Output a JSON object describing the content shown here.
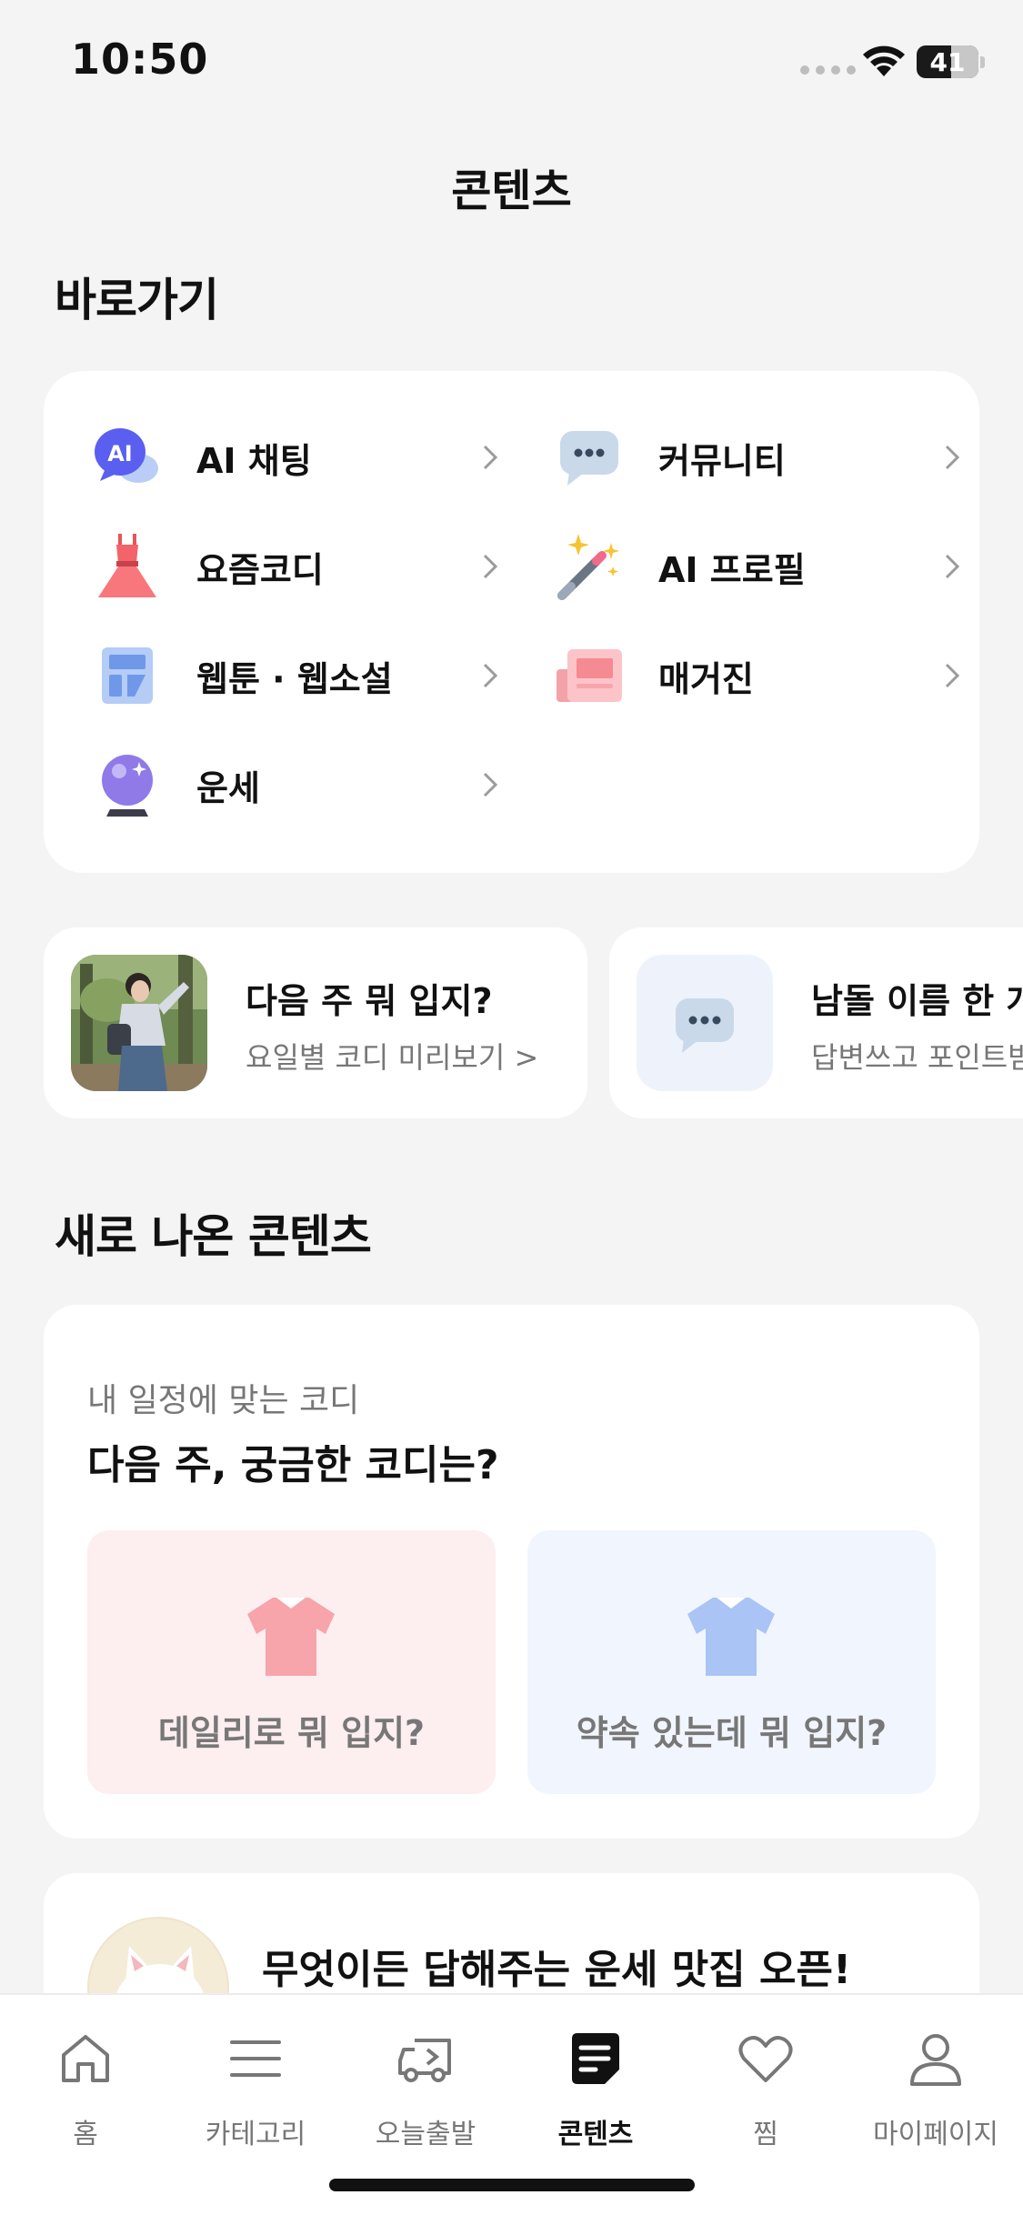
{
  "status_bar": {
    "time": "10:50",
    "battery": "41"
  },
  "header": {
    "title": "콘텐츠"
  },
  "shortcuts": {
    "title": "바로가기",
    "items": [
      {
        "label": "AI 채팅",
        "icon": "ai-chat-bubble-icon",
        "icon_text": "AI"
      },
      {
        "label": "커뮤니티",
        "icon": "community-chat-icon"
      },
      {
        "label": "요즘코디",
        "icon": "dress-icon"
      },
      {
        "label": "AI 프로필",
        "icon": "magic-wand-icon"
      },
      {
        "label": "웹툰 · 웹소설",
        "icon": "webtoon-icon"
      },
      {
        "label": "매거진",
        "icon": "magazine-icon"
      },
      {
        "label": "운세",
        "icon": "crystal-ball-icon"
      }
    ]
  },
  "banners": [
    {
      "title": "다음 주 뭐 입지?",
      "subtitle": "요일별 코디 미리보기 >"
    },
    {
      "title": "남돌 이름 한 개",
      "subtitle": "답변쓰고 포인트받"
    }
  ],
  "new_contents": {
    "title": "새로 나온 콘텐츠",
    "card": {
      "eyebrow": "내 일정에 맞는 코디",
      "title": "다음 주, 궁금한 코디는?",
      "options": [
        {
          "label": "데일리로 뭐 입지?",
          "bg": "#fdeef0",
          "shirt_color": "#f7a4ab"
        },
        {
          "label": "약속 있는데 뭐 입지?",
          "bg": "#f1f5fd",
          "shirt_color": "#a9c4f5"
        }
      ]
    },
    "promo": {
      "title": "무엇이든 답해주는 운세 맛집 오픈!"
    }
  },
  "tab_bar": {
    "active": "콘텐츠",
    "tabs": [
      {
        "label": "홈",
        "icon": "home-icon"
      },
      {
        "label": "카테고리",
        "icon": "menu-icon"
      },
      {
        "label": "오늘출발",
        "icon": "truck-icon"
      },
      {
        "label": "콘텐츠",
        "icon": "contents-icon"
      },
      {
        "label": "찜",
        "icon": "heart-icon"
      },
      {
        "label": "마이페이지",
        "icon": "person-icon"
      }
    ]
  }
}
